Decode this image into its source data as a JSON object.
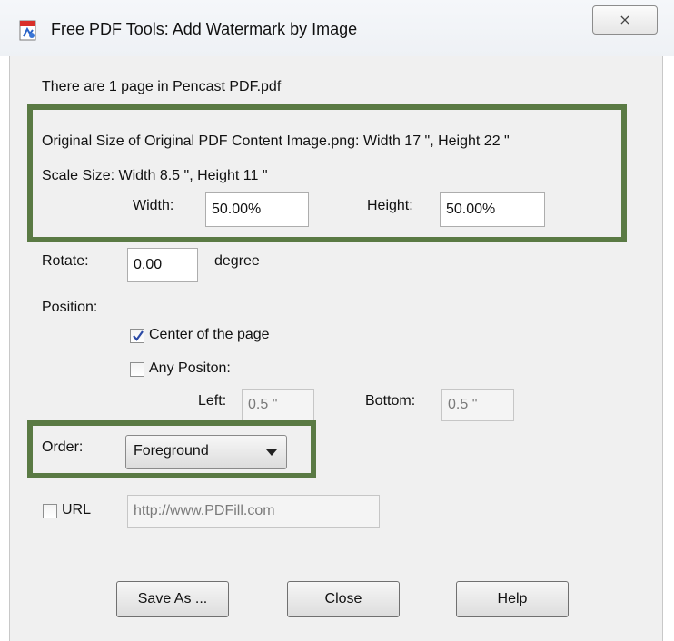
{
  "window": {
    "title": "Free PDF Tools: Add Watermark by Image",
    "close_glyph": "⨯"
  },
  "info": {
    "page_count_text": "There are 1 page in Pencast PDF.pdf",
    "original_size_text": "Original Size of Original PDF Content Image.png:  Width 17 \",   Height 22 \"",
    "scale_size_text": "Scale Size:  Width 8.5 \",   Height 11 \""
  },
  "scale": {
    "width_label": "Width:",
    "width_value": "50.00%",
    "height_label": "Height:",
    "height_value": "50.00%"
  },
  "rotate": {
    "label": "Rotate:",
    "value": "0.00",
    "unit": "degree"
  },
  "position": {
    "label": "Position:",
    "center_label": "Center of the page",
    "center_checked": true,
    "any_label": "Any Positon:",
    "any_checked": false,
    "left_label": "Left:",
    "left_value": "0.5 \"",
    "bottom_label": "Bottom:",
    "bottom_value": "0.5 \""
  },
  "order": {
    "label": "Order:",
    "selected": "Foreground"
  },
  "url": {
    "label": "URL",
    "checked": false,
    "value": "http://www.PDFill.com"
  },
  "buttons": {
    "save_as": "Save As ...",
    "close": "Close",
    "help": "Help"
  },
  "colors": {
    "highlight": "#5a7a44"
  }
}
